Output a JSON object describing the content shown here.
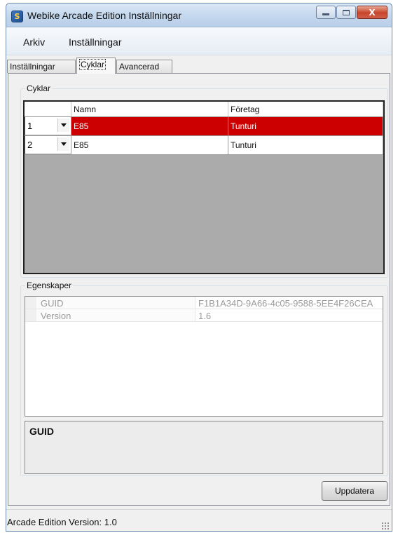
{
  "window": {
    "title": "Webike Arcade Edition Inställningar",
    "app_icon_glyph": "S",
    "close_glyph": "X"
  },
  "menu": {
    "items": [
      "Arkiv",
      "Inställningar"
    ]
  },
  "tabs": [
    {
      "label": "Inställningar",
      "active": false
    },
    {
      "label": "Cyklar",
      "active": true
    },
    {
      "label": "Avancerad",
      "active": false
    }
  ],
  "bikes_group": {
    "title": "Cyklar",
    "columns": [
      "",
      "Namn",
      "Företag"
    ],
    "rows": [
      {
        "index": "1",
        "name": "E85",
        "company": "Tunturi",
        "selected": true
      },
      {
        "index": "2",
        "name": "E85",
        "company": "Tunturi",
        "selected": false
      }
    ],
    "selected_color": "#cc0000"
  },
  "properties_group": {
    "title": "Egenskaper",
    "rows": [
      {
        "name": "GUID",
        "value": "F1B1A34D-9A66-4c05-9588-5EE4F26CEA"
      },
      {
        "name": "Version",
        "value": "1.6"
      }
    ],
    "help_title": "GUID"
  },
  "buttons": {
    "update_label": "Uppdatera"
  },
  "status": {
    "text": "Arcade Edition Version: 1.0"
  },
  "icons": [
    "app-icon",
    "minimize-icon",
    "maximize-icon",
    "close-icon",
    "dropdown-arrow-icon",
    "resize-grip-icon"
  ]
}
